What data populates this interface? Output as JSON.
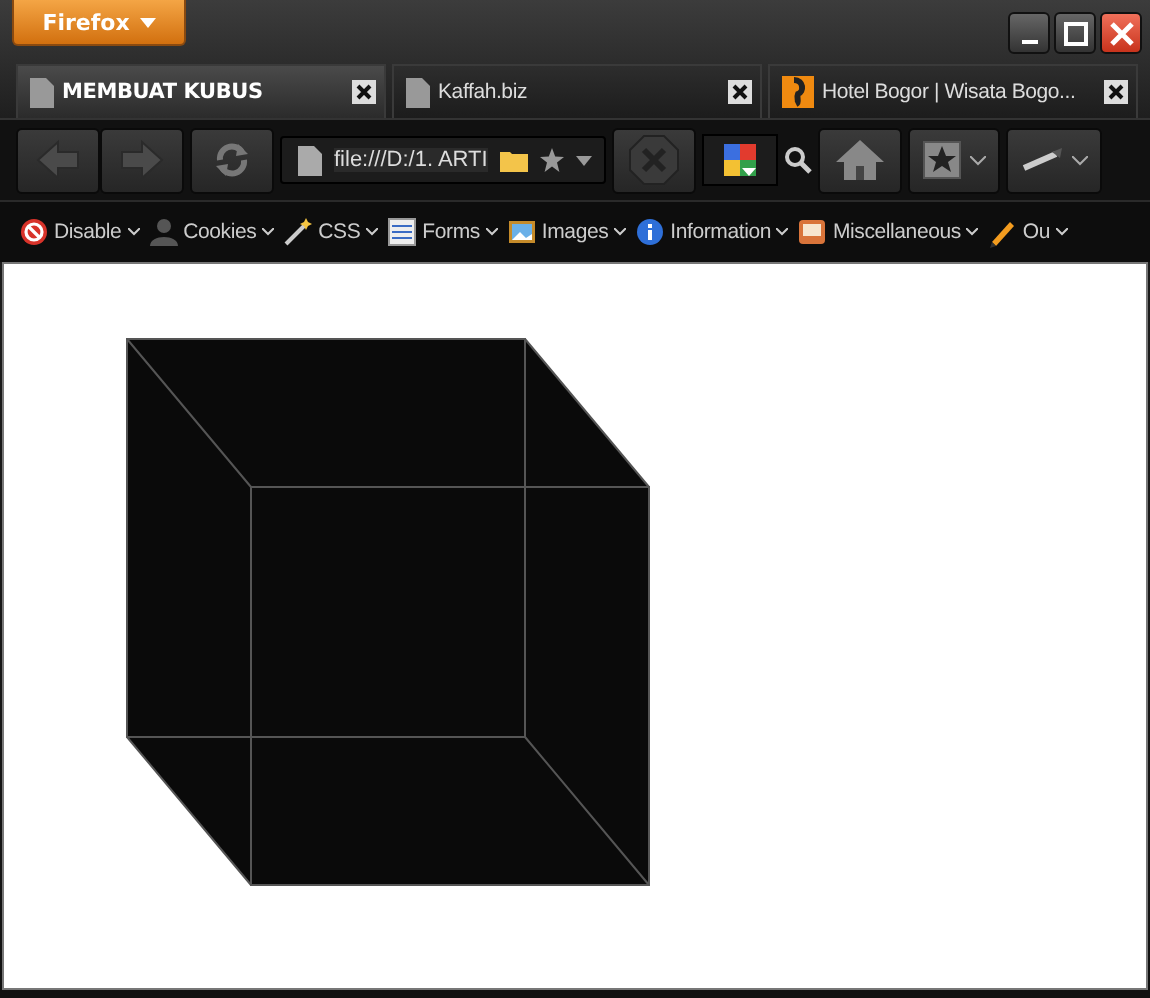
{
  "app_button": {
    "label": "Firefox"
  },
  "tabs": [
    {
      "title": "MEMBUAT KUBUS",
      "selected": true,
      "kind": "page"
    },
    {
      "title": "Kaffah.biz",
      "selected": false,
      "kind": "page"
    },
    {
      "title": "Hotel Bogor | Wisata Bogo...",
      "selected": false,
      "kind": "site"
    }
  ],
  "address_bar": {
    "value": "file:///D:/1. ARTI"
  },
  "dev_toolbar": [
    {
      "label": "Disable"
    },
    {
      "label": "Cookies"
    },
    {
      "label": "CSS"
    },
    {
      "label": "Forms"
    },
    {
      "label": "Images"
    },
    {
      "label": "Information"
    },
    {
      "label": "Miscellaneous"
    },
    {
      "label": "Ou"
    }
  ]
}
